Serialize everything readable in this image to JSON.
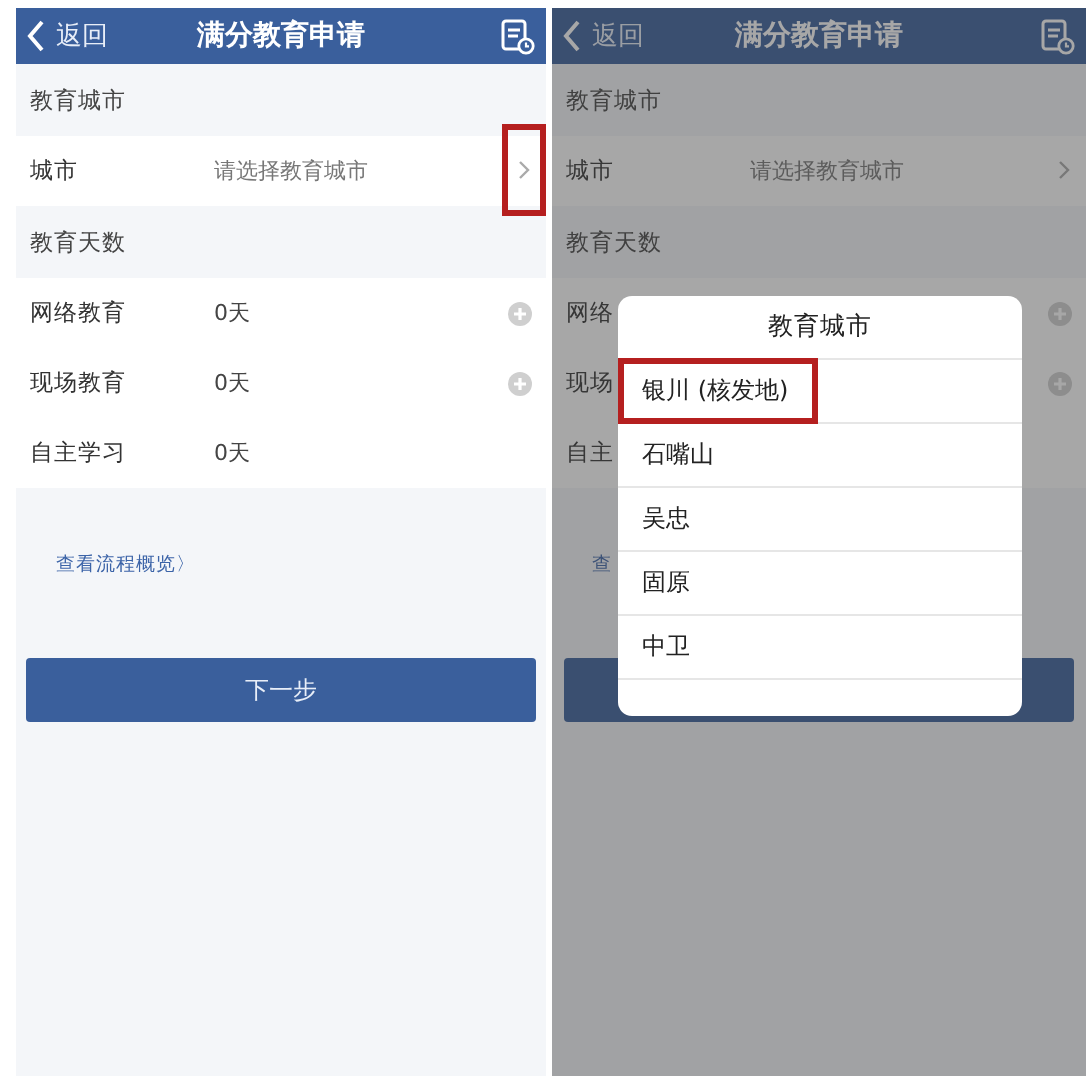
{
  "screens": [
    {
      "nav": {
        "back": "返回",
        "title": "满分教育申请"
      },
      "sections": [
        {
          "header": "教育城市",
          "rows": [
            {
              "kind": "select",
              "label": "城市",
              "placeholder": "请选择教育城市",
              "highlighted": true
            }
          ]
        },
        {
          "header": "教育天数",
          "rows": [
            {
              "kind": "add",
              "label": "网络教育",
              "value": "0天"
            },
            {
              "kind": "add",
              "label": "现场教育",
              "value": "0天"
            },
            {
              "kind": "plain",
              "label": "自主学习",
              "value": "0天"
            }
          ]
        }
      ],
      "link": "查看流程概览〉",
      "button": "下一步"
    },
    {
      "nav": {
        "back": "返回",
        "title": "满分教育申请"
      },
      "sections": [
        {
          "header": "教育城市",
          "rows": [
            {
              "kind": "select",
              "label": "城市",
              "placeholder": "请选择教育城市",
              "highlighted": false
            }
          ]
        },
        {
          "header": "教育天数",
          "rows": [
            {
              "kind": "add",
              "label": "网络"
            },
            {
              "kind": "add",
              "label": "现场"
            },
            {
              "kind": "plain",
              "label": "自主"
            }
          ]
        }
      ],
      "link": "查",
      "popup": {
        "title": "教育城市",
        "options": [
          {
            "label": "银川 (核发地)",
            "highlighted": true
          },
          {
            "label": "石嘴山",
            "highlighted": false
          },
          {
            "label": "吴忠",
            "highlighted": false
          },
          {
            "label": "固原",
            "highlighted": false
          },
          {
            "label": "中卫",
            "highlighted": false
          }
        ]
      }
    }
  ]
}
